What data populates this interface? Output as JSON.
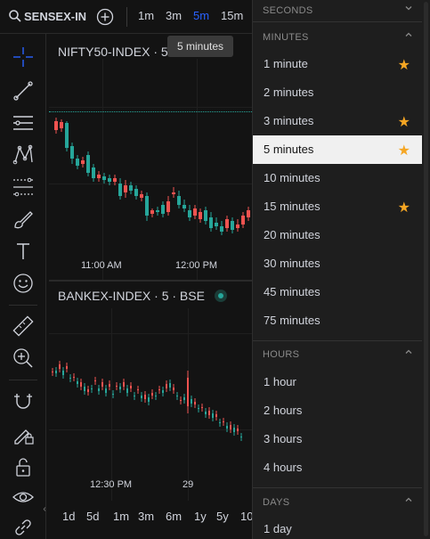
{
  "topbar": {
    "symbol": "SENSEX-IN",
    "intervals": [
      "1m",
      "3m",
      "5m",
      "15m"
    ],
    "active_interval": "5m"
  },
  "tooltip": "5 minutes",
  "pane1": {
    "title": "NIFTY50-INDEX · 5",
    "x_labels": [
      "11:00 AM",
      "12:00 PM"
    ]
  },
  "pane2": {
    "title": "BANKEX-INDEX · 5 · BSE",
    "x_labels": [
      "12:30 PM",
      "29"
    ]
  },
  "ranges": [
    "1d",
    "5d",
    "1m",
    "3m",
    "6m",
    "1y",
    "5y",
    "10"
  ],
  "dropdown": {
    "sections": [
      {
        "label": "SECONDS",
        "expanded": false,
        "items": []
      },
      {
        "label": "MINUTES",
        "expanded": true,
        "items": [
          {
            "label": "1 minute",
            "starred": true
          },
          {
            "label": "2 minutes",
            "starred": false
          },
          {
            "label": "3 minutes",
            "starred": true
          },
          {
            "label": "5 minutes",
            "starred": true,
            "selected": true
          },
          {
            "label": "10 minutes",
            "starred": false
          },
          {
            "label": "15 minutes",
            "starred": true
          },
          {
            "label": "20 minutes",
            "starred": false
          },
          {
            "label": "30 minutes",
            "starred": false
          },
          {
            "label": "45 minutes",
            "starred": false
          },
          {
            "label": "75 minutes",
            "starred": false
          }
        ]
      },
      {
        "label": "HOURS",
        "expanded": true,
        "items": [
          {
            "label": "1 hour",
            "starred": false
          },
          {
            "label": "2 hours",
            "starred": false
          },
          {
            "label": "3 hours",
            "starred": false
          },
          {
            "label": "4 hours",
            "starred": false
          }
        ]
      },
      {
        "label": "DAYS",
        "expanded": true,
        "items": [
          {
            "label": "1 day",
            "starred": false
          }
        ]
      }
    ]
  },
  "colors": {
    "up": "#26a69a",
    "down": "#ef5350",
    "accent": "#2962ff",
    "star": "#f5a623"
  }
}
